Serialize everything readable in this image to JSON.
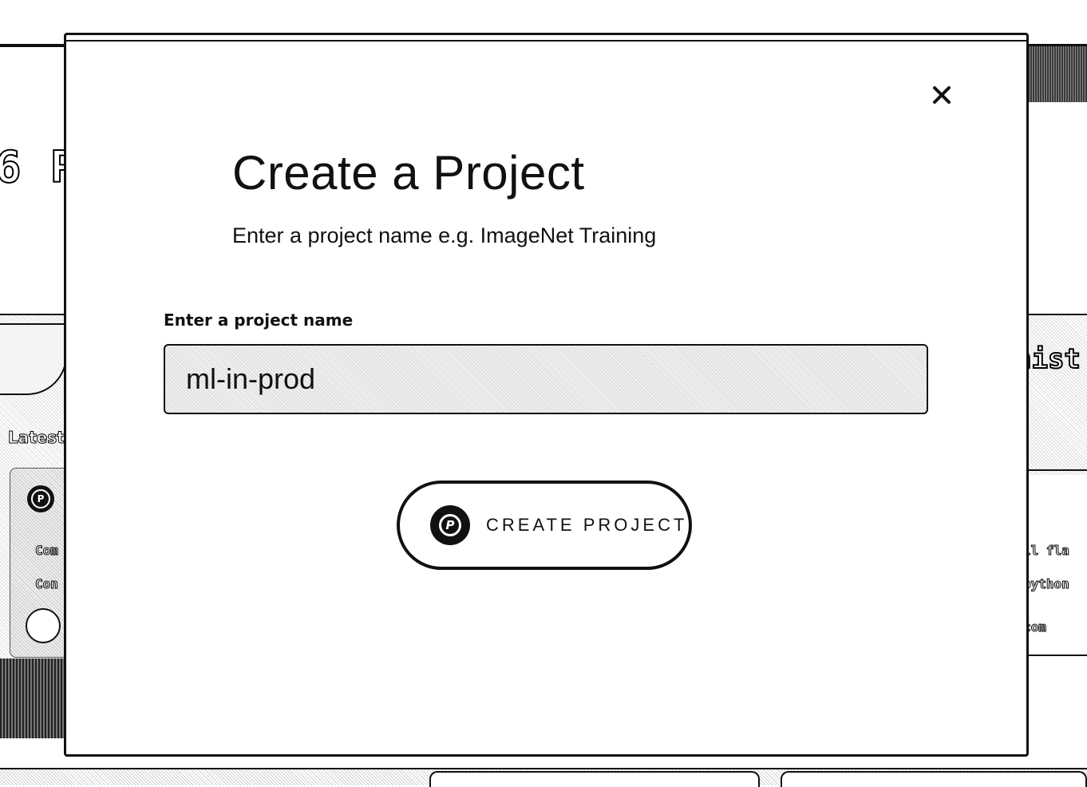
{
  "background": {
    "heading_fragment": "6 P",
    "latest_label": "Latest",
    "card_line_1": "Com",
    "card_line_2": "Con",
    "right_title_fragment": "nist",
    "right_line_1": "ll fla",
    "right_line_2": "python",
    "right_line_3": "com"
  },
  "modal": {
    "close_icon": "close-icon",
    "title": "Create a Project",
    "subtitle": "Enter a project name e.g. ImageNet Training",
    "field_label": "Enter a project name",
    "project_name_value": "ml-in-prod",
    "create_button_label": "CREATE PROJECT",
    "create_button_icon": "p-logo-icon",
    "create_button_icon_letter": "P"
  },
  "colors": {
    "foreground": "#111111",
    "background": "#ffffff"
  }
}
